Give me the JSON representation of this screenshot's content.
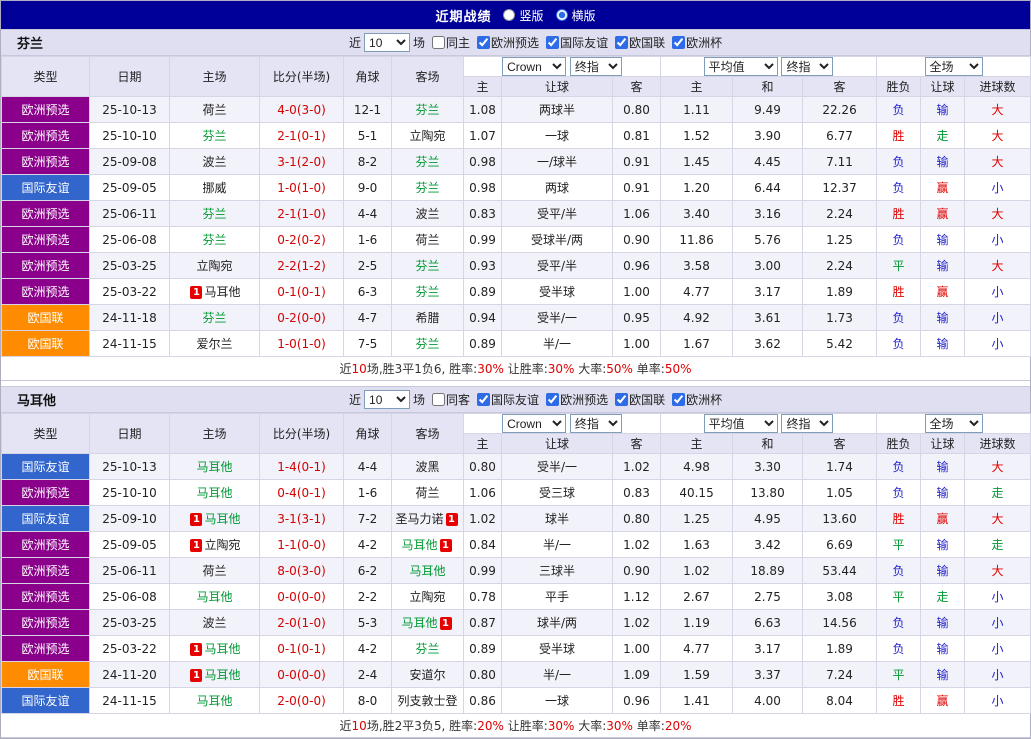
{
  "titlebar": {
    "title": "近期战绩",
    "radio_vertical": "竖版",
    "radio_horizontal": "横版"
  },
  "table_header": {
    "near": "近",
    "games": "10",
    "games_suffix": "场",
    "col_type": "类型",
    "col_date": "日期",
    "col_home": "主场",
    "col_score": "比分(半场)",
    "col_corner": "角球",
    "col_away": "客场",
    "dd_bookmaker": "Crown",
    "dd_book_mode": "终指",
    "dd_average": "平均值",
    "dd_avg_mode": "终指",
    "dd_scope": "全场",
    "sub": [
      "主",
      "让球",
      "客",
      "主",
      "和",
      "客",
      "胜负",
      "让球",
      "进球数"
    ]
  },
  "colors": {
    "type": {
      "purple": "#8b008b",
      "blue": "#3366cc",
      "orange": "#ff8c00"
    },
    "result": {
      "r": "#e00000",
      "g": "#009933",
      "b": "#2222cc"
    },
    "score": "#d40000",
    "team_hl": "#009933"
  },
  "sections": [
    {
      "team": "芬兰",
      "same": {
        "label": "同主",
        "checked": false
      },
      "filters": [
        {
          "label": "欧洲预选",
          "checked": true
        },
        {
          "label": "国际友谊",
          "checked": true
        },
        {
          "label": "欧国联",
          "checked": true
        },
        {
          "label": "欧洲杯",
          "checked": true
        }
      ],
      "rows": [
        {
          "type": "欧洲预选",
          "tc": "purple",
          "date": "25-10-13",
          "home": {
            "n": "荷兰"
          },
          "score": "4-0(3-0)",
          "corner": "12-1",
          "away": {
            "n": "芬兰",
            "hl": true
          },
          "o": [
            "1.08",
            "两球半",
            "0.80",
            "1.11",
            "9.49",
            "22.26"
          ],
          "r": [
            [
              "负",
              "b"
            ],
            [
              "输",
              "b"
            ],
            [
              "大",
              "r"
            ]
          ]
        },
        {
          "type": "欧洲预选",
          "tc": "purple",
          "date": "25-10-10",
          "home": {
            "n": "芬兰",
            "hl": true
          },
          "score": "2-1(0-1)",
          "corner": "5-1",
          "away": {
            "n": "立陶宛"
          },
          "o": [
            "1.07",
            "一球",
            "0.81",
            "1.52",
            "3.90",
            "6.77"
          ],
          "r": [
            [
              "胜",
              "r"
            ],
            [
              "走",
              "g"
            ],
            [
              "大",
              "r"
            ]
          ]
        },
        {
          "type": "欧洲预选",
          "tc": "purple",
          "date": "25-09-08",
          "home": {
            "n": "波兰"
          },
          "score": "3-1(2-0)",
          "corner": "8-2",
          "away": {
            "n": "芬兰",
            "hl": true
          },
          "o": [
            "0.98",
            "一/球半",
            "0.91",
            "1.45",
            "4.45",
            "7.11"
          ],
          "r": [
            [
              "负",
              "b"
            ],
            [
              "输",
              "b"
            ],
            [
              "大",
              "r"
            ]
          ]
        },
        {
          "type": "国际友谊",
          "tc": "blue",
          "date": "25-09-05",
          "home": {
            "n": "挪威"
          },
          "score": "1-0(1-0)",
          "corner": "9-0",
          "away": {
            "n": "芬兰",
            "hl": true
          },
          "o": [
            "0.98",
            "两球",
            "0.91",
            "1.20",
            "6.44",
            "12.37"
          ],
          "r": [
            [
              "负",
              "b"
            ],
            [
              "赢",
              "r"
            ],
            [
              "小",
              "b"
            ]
          ]
        },
        {
          "type": "欧洲预选",
          "tc": "purple",
          "date": "25-06-11",
          "home": {
            "n": "芬兰",
            "hl": true
          },
          "score": "2-1(1-0)",
          "corner": "4-4",
          "away": {
            "n": "波兰"
          },
          "o": [
            "0.83",
            "受平/半",
            "1.06",
            "3.40",
            "3.16",
            "2.24"
          ],
          "r": [
            [
              "胜",
              "r"
            ],
            [
              "赢",
              "r"
            ],
            [
              "大",
              "r"
            ]
          ]
        },
        {
          "type": "欧洲预选",
          "tc": "purple",
          "date": "25-06-08",
          "home": {
            "n": "芬兰",
            "hl": true
          },
          "score": "0-2(0-2)",
          "corner": "1-6",
          "away": {
            "n": "荷兰"
          },
          "o": [
            "0.99",
            "受球半/两",
            "0.90",
            "11.86",
            "5.76",
            "1.25"
          ],
          "r": [
            [
              "负",
              "b"
            ],
            [
              "输",
              "b"
            ],
            [
              "小",
              "b"
            ]
          ]
        },
        {
          "type": "欧洲预选",
          "tc": "purple",
          "date": "25-03-25",
          "home": {
            "n": "立陶宛"
          },
          "score": "2-2(1-2)",
          "corner": "2-5",
          "away": {
            "n": "芬兰",
            "hl": true
          },
          "o": [
            "0.93",
            "受平/半",
            "0.96",
            "3.58",
            "3.00",
            "2.24"
          ],
          "r": [
            [
              "平",
              "g"
            ],
            [
              "输",
              "b"
            ],
            [
              "大",
              "r"
            ]
          ]
        },
        {
          "type": "欧洲预选",
          "tc": "purple",
          "date": "25-03-22",
          "home": {
            "n": "马耳他",
            "cb": true
          },
          "score": "0-1(0-1)",
          "corner": "6-3",
          "away": {
            "n": "芬兰",
            "hl": true
          },
          "o": [
            "0.89",
            "受半球",
            "1.00",
            "4.77",
            "3.17",
            "1.89"
          ],
          "r": [
            [
              "胜",
              "r"
            ],
            [
              "赢",
              "r"
            ],
            [
              "小",
              "b"
            ]
          ]
        },
        {
          "type": "欧国联",
          "tc": "orange",
          "date": "24-11-18",
          "home": {
            "n": "芬兰",
            "hl": true
          },
          "score": "0-2(0-0)",
          "corner": "4-7",
          "away": {
            "n": "希腊"
          },
          "o": [
            "0.94",
            "受半/一",
            "0.95",
            "4.92",
            "3.61",
            "1.73"
          ],
          "r": [
            [
              "负",
              "b"
            ],
            [
              "输",
              "b"
            ],
            [
              "小",
              "b"
            ]
          ]
        },
        {
          "type": "欧国联",
          "tc": "orange",
          "date": "24-11-15",
          "home": {
            "n": "爱尔兰"
          },
          "score": "1-0(1-0)",
          "corner": "7-5",
          "away": {
            "n": "芬兰",
            "hl": true
          },
          "o": [
            "0.89",
            "半/一",
            "1.00",
            "1.67",
            "3.62",
            "5.42"
          ],
          "r": [
            [
              "负",
              "b"
            ],
            [
              "输",
              "b"
            ],
            [
              "小",
              "b"
            ]
          ]
        }
      ],
      "summary": [
        {
          "t": "近",
          "c": "#333333"
        },
        {
          "t": "10",
          "c": "#e00000"
        },
        {
          "t": "场,胜3平1负6, 胜率:",
          "c": "#333333"
        },
        {
          "t": "30%",
          "c": "#e00000"
        },
        {
          "t": " 让胜率:",
          "c": "#333333"
        },
        {
          "t": "30%",
          "c": "#e00000"
        },
        {
          "t": " 大率:",
          "c": "#333333"
        },
        {
          "t": "50%",
          "c": "#e00000"
        },
        {
          "t": " 单率:",
          "c": "#333333"
        },
        {
          "t": "50%",
          "c": "#e00000"
        }
      ]
    },
    {
      "team": "马耳他",
      "same": {
        "label": "同客",
        "checked": false
      },
      "filters": [
        {
          "label": "国际友谊",
          "checked": true
        },
        {
          "label": "欧洲预选",
          "checked": true
        },
        {
          "label": "欧国联",
          "checked": true
        },
        {
          "label": "欧洲杯",
          "checked": true
        }
      ],
      "rows": [
        {
          "type": "国际友谊",
          "tc": "blue",
          "date": "25-10-13",
          "home": {
            "n": "马耳他",
            "hl": true
          },
          "score": "1-4(0-1)",
          "corner": "4-4",
          "away": {
            "n": "波黑"
          },
          "o": [
            "0.80",
            "受半/一",
            "1.02",
            "4.98",
            "3.30",
            "1.74"
          ],
          "r": [
            [
              "负",
              "b"
            ],
            [
              "输",
              "b"
            ],
            [
              "大",
              "r"
            ]
          ]
        },
        {
          "type": "欧洲预选",
          "tc": "purple",
          "date": "25-10-10",
          "home": {
            "n": "马耳他",
            "hl": true
          },
          "score": "0-4(0-1)",
          "corner": "1-6",
          "away": {
            "n": "荷兰"
          },
          "o": [
            "1.06",
            "受三球",
            "0.83",
            "40.15",
            "13.80",
            "1.05"
          ],
          "r": [
            [
              "负",
              "b"
            ],
            [
              "输",
              "b"
            ],
            [
              "走",
              "g"
            ]
          ]
        },
        {
          "type": "国际友谊",
          "tc": "blue",
          "date": "25-09-10",
          "home": {
            "n": "马耳他",
            "hl": true,
            "cb": true
          },
          "score": "3-1(3-1)",
          "corner": "7-2",
          "away": {
            "n": "圣马力诺",
            "ca": true
          },
          "o": [
            "1.02",
            "球半",
            "0.80",
            "1.25",
            "4.95",
            "13.60"
          ],
          "r": [
            [
              "胜",
              "r"
            ],
            [
              "赢",
              "r"
            ],
            [
              "大",
              "r"
            ]
          ]
        },
        {
          "type": "欧洲预选",
          "tc": "purple",
          "date": "25-09-05",
          "home": {
            "n": "立陶宛",
            "cb": true
          },
          "score": "1-1(0-0)",
          "corner": "4-2",
          "away": {
            "n": "马耳他",
            "hl": true,
            "ca": true
          },
          "o": [
            "0.84",
            "半/一",
            "1.02",
            "1.63",
            "3.42",
            "6.69"
          ],
          "r": [
            [
              "平",
              "g"
            ],
            [
              "输",
              "b"
            ],
            [
              "走",
              "g"
            ]
          ]
        },
        {
          "type": "欧洲预选",
          "tc": "purple",
          "date": "25-06-11",
          "home": {
            "n": "荷兰"
          },
          "score": "8-0(3-0)",
          "corner": "6-2",
          "away": {
            "n": "马耳他",
            "hl": true
          },
          "o": [
            "0.99",
            "三球半",
            "0.90",
            "1.02",
            "18.89",
            "53.44"
          ],
          "r": [
            [
              "负",
              "b"
            ],
            [
              "输",
              "b"
            ],
            [
              "大",
              "r"
            ]
          ]
        },
        {
          "type": "欧洲预选",
          "tc": "purple",
          "date": "25-06-08",
          "home": {
            "n": "马耳他",
            "hl": true
          },
          "score": "0-0(0-0)",
          "corner": "2-2",
          "away": {
            "n": "立陶宛"
          },
          "o": [
            "0.78",
            "平手",
            "1.12",
            "2.67",
            "2.75",
            "3.08"
          ],
          "r": [
            [
              "平",
              "g"
            ],
            [
              "走",
              "g"
            ],
            [
              "小",
              "b"
            ]
          ]
        },
        {
          "type": "欧洲预选",
          "tc": "purple",
          "date": "25-03-25",
          "home": {
            "n": "波兰"
          },
          "score": "2-0(1-0)",
          "corner": "5-3",
          "away": {
            "n": "马耳他",
            "hl": true,
            "ca": true
          },
          "o": [
            "0.87",
            "球半/两",
            "1.02",
            "1.19",
            "6.63",
            "14.56"
          ],
          "r": [
            [
              "负",
              "b"
            ],
            [
              "输",
              "b"
            ],
            [
              "小",
              "b"
            ]
          ]
        },
        {
          "type": "欧洲预选",
          "tc": "purple",
          "date": "25-03-22",
          "home": {
            "n": "马耳他",
            "hl": true,
            "cb": true
          },
          "score": "0-1(0-1)",
          "corner": "4-2",
          "away": {
            "n": "芬兰",
            "hl": true
          },
          "o": [
            "0.89",
            "受半球",
            "1.00",
            "4.77",
            "3.17",
            "1.89"
          ],
          "r": [
            [
              "负",
              "b"
            ],
            [
              "输",
              "b"
            ],
            [
              "小",
              "b"
            ]
          ]
        },
        {
          "type": "欧国联",
          "tc": "orange",
          "date": "24-11-20",
          "home": {
            "n": "马耳他",
            "hl": true,
            "cb": true
          },
          "score": "0-0(0-0)",
          "corner": "2-4",
          "away": {
            "n": "安道尔"
          },
          "o": [
            "0.80",
            "半/一",
            "1.09",
            "1.59",
            "3.37",
            "7.24"
          ],
          "r": [
            [
              "平",
              "g"
            ],
            [
              "输",
              "b"
            ],
            [
              "小",
              "b"
            ]
          ]
        },
        {
          "type": "国际友谊",
          "tc": "blue",
          "date": "24-11-15",
          "home": {
            "n": "马耳他",
            "hl": true
          },
          "score": "2-0(0-0)",
          "corner": "8-0",
          "away": {
            "n": "列支敦士登"
          },
          "o": [
            "0.86",
            "一球",
            "0.96",
            "1.41",
            "4.00",
            "8.04"
          ],
          "r": [
            [
              "胜",
              "r"
            ],
            [
              "赢",
              "r"
            ],
            [
              "小",
              "b"
            ]
          ]
        }
      ],
      "summary": [
        {
          "t": "近",
          "c": "#333333"
        },
        {
          "t": "10",
          "c": "#e00000"
        },
        {
          "t": "场,胜2平3负5, 胜率:",
          "c": "#333333"
        },
        {
          "t": "20%",
          "c": "#e00000"
        },
        {
          "t": " 让胜率:",
          "c": "#333333"
        },
        {
          "t": "30%",
          "c": "#e00000"
        },
        {
          "t": " 大率:",
          "c": "#333333"
        },
        {
          "t": "30%",
          "c": "#e00000"
        },
        {
          "t": " 单率:",
          "c": "#333333"
        },
        {
          "t": "20%",
          "c": "#e00000"
        }
      ]
    }
  ]
}
